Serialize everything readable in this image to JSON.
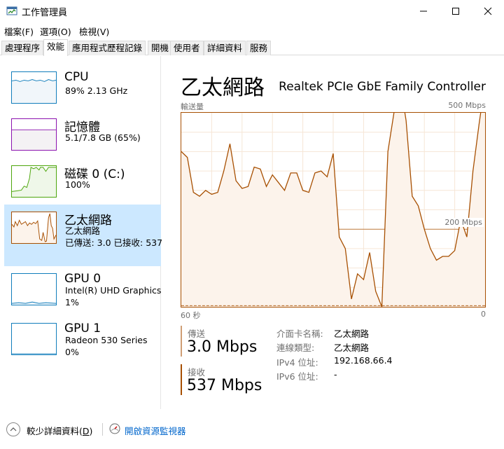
{
  "window": {
    "title": "工作管理員"
  },
  "menu": [
    "檔案(F)",
    "選項(O)",
    "檢視(V)"
  ],
  "tabs": [
    "處理程序",
    "效能",
    "應用程式歷程記錄",
    "開機",
    "使用者",
    "詳細資料",
    "服務"
  ],
  "active_tab": "效能",
  "sidebar": {
    "items": [
      {
        "name": "CPU",
        "line1": "89%  2.13 GHz",
        "line2": "",
        "color": "#117dbb",
        "fill": "#f1f6fa"
      },
      {
        "name": "記憶體",
        "line1": "5.1/7.8 GB (65%)",
        "line2": "",
        "color": "#8b12ae",
        "fill": "#f4f2f4"
      },
      {
        "name": "磁碟 0 (C:)",
        "line1": "100%",
        "line2": "",
        "color": "#4da60c",
        "fill": "#eff7e9"
      },
      {
        "name": "乙太網路",
        "line1": "乙太網路",
        "line2": "已傳送: 3.0  已接收: 537",
        "color": "#a74f01",
        "fill": "#fcf3eb"
      },
      {
        "name": "GPU 0",
        "line1": "Intel(R) UHD Graphics",
        "line2": "1%",
        "color": "#117dbb",
        "fill": "#f1f6fa"
      },
      {
        "name": "GPU 1",
        "line1": "Radeon 530 Series",
        "line2": "0%",
        "color": "#117dbb",
        "fill": "#f1f6fa"
      }
    ]
  },
  "detail": {
    "title": "乙太網路",
    "device": "Realtek PCIe GbE Family Controller",
    "throughput_label": "輸送量",
    "max_label": "500 Mbps",
    "mid_label": "200 Mbps",
    "time_left": "60 秒",
    "time_right": "0",
    "send_label": "傳送",
    "send_value": "3.0 Mbps",
    "recv_label": "接收",
    "recv_value": "537 Mbps",
    "properties": [
      {
        "label": "介面卡名稱:",
        "value": "乙太網路"
      },
      {
        "label": "連線類型:",
        "value": "乙太網路"
      },
      {
        "label": "IPv4 位址:",
        "value": "192.168.66.4"
      },
      {
        "label": "IPv6 位址:",
        "value": "-"
      }
    ]
  },
  "chart_data": {
    "type": "area",
    "ylim": [
      0,
      500
    ],
    "x_range_seconds": [
      60,
      0
    ],
    "series": [
      {
        "name": "接收",
        "color": "#a74f01",
        "values": [
          400,
          385,
          295,
          285,
          300,
          290,
          295,
          350,
          420,
          325,
          305,
          310,
          360,
          355,
          310,
          340,
          320,
          300,
          345,
          345,
          300,
          295,
          345,
          350,
          335,
          395,
          180,
          150,
          20,
          85,
          70,
          140,
          40,
          0,
          400,
          500,
          580,
          480,
          285,
          260,
          200,
          150,
          120,
          130,
          130,
          145,
          225,
          180,
          350,
          470,
          580
        ]
      },
      {
        "name": "傳送",
        "color": "#a74f01",
        "values": [
          3,
          3,
          3,
          3,
          3,
          3,
          3,
          3,
          3,
          3,
          3,
          3,
          3,
          3,
          3,
          3,
          3,
          3,
          3,
          3,
          3,
          3,
          3,
          3,
          3,
          3,
          3,
          3,
          3,
          3,
          3,
          3,
          3,
          3,
          3,
          3,
          3,
          3,
          3,
          3,
          3,
          3,
          3,
          3,
          3,
          3,
          3,
          3,
          3,
          3,
          3
        ]
      }
    ]
  }
}
